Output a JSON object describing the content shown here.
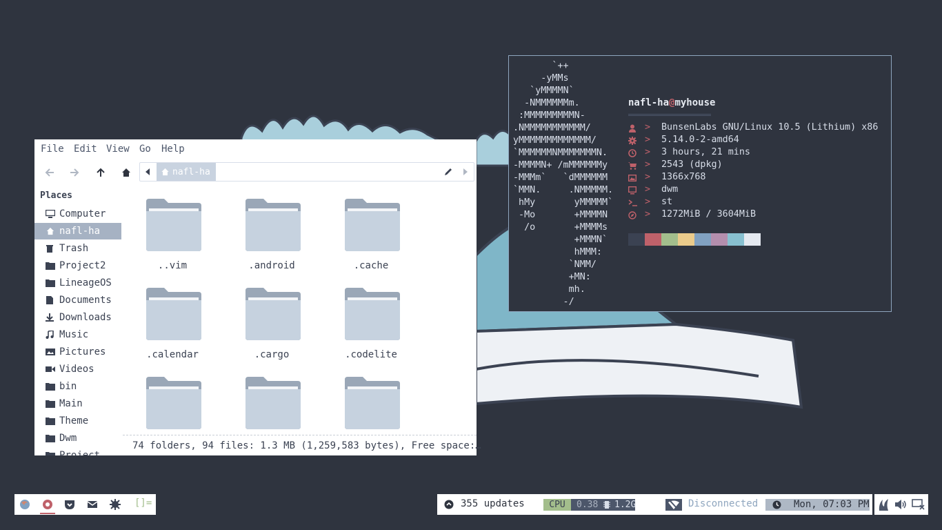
{
  "file_manager": {
    "menu": [
      "File",
      "Edit",
      "View",
      "Go",
      "Help"
    ],
    "path_crumb": "nafl-ha",
    "places_header": "Places",
    "places": [
      {
        "label": "Computer",
        "icon": "computer-icon"
      },
      {
        "label": "nafl-ha",
        "icon": "home-icon",
        "selected": true
      },
      {
        "label": "Trash",
        "icon": "trash-icon"
      },
      {
        "label": "Project2",
        "icon": "folder-icon"
      },
      {
        "label": "LineageOS",
        "icon": "folder-icon"
      },
      {
        "label": "Documents",
        "icon": "documents-icon"
      },
      {
        "label": "Downloads",
        "icon": "download-icon"
      },
      {
        "label": "Music",
        "icon": "music-icon"
      },
      {
        "label": "Pictures",
        "icon": "pictures-icon"
      },
      {
        "label": "Videos",
        "icon": "videos-icon"
      },
      {
        "label": "bin",
        "icon": "folder-icon"
      },
      {
        "label": "Main",
        "icon": "folder-icon"
      },
      {
        "label": "Theme",
        "icon": "folder-icon"
      },
      {
        "label": "Dwm",
        "icon": "folder-icon"
      },
      {
        "label": "Project",
        "icon": "folder-icon"
      }
    ],
    "files": [
      "..vim",
      ".android",
      ".cache",
      ".calendar",
      ".cargo",
      ".codelite",
      "",
      "",
      ""
    ],
    "status": "74 folders, 94 files: 1.3 MB (1,259,583 bytes), Free space:…"
  },
  "terminal": {
    "logo": "       `++\n     -yMMs\n   `yMMMMN`\n  -NMMMMMMm.\n :MMMMMMMMMN-\n.NMMMMMMMMMMM/\nyMMMMMMMMMMMMM/\n`MMMMMMNMMMMMMMN.\n-MMMMN+ /mMMMMMMy\n-MMMm`   `dMMMMMM\n`MMN.     .NMMMMM.\n hMy       yMMMMM`\n -Mo       +MMMMN\n  /o       +MMMMs\n           +MMMN`\n           hMMM:\n          `NMM/\n          +MN:\n          mh.\n         -/",
    "user": "nafl-ha",
    "at": "@",
    "host": "myhouse",
    "arrow": ">",
    "info": [
      {
        "icon": "user-icon",
        "value": "BunsenLabs GNU/Linux 10.5 (Lithium) x86"
      },
      {
        "icon": "gear-icon",
        "value": "5.14.0-2-amd64"
      },
      {
        "icon": "clock-icon",
        "value": "3 hours, 21 mins"
      },
      {
        "icon": "cart-icon",
        "value": "2543 (dpkg)"
      },
      {
        "icon": "image-icon",
        "value": "1366x768"
      },
      {
        "icon": "monitor-icon",
        "value": "dwm"
      },
      {
        "icon": "terminal-icon",
        "value": "st"
      },
      {
        "icon": "compass-icon",
        "value": "1272MiB / 3604MiB"
      }
    ],
    "palette": [
      "#3b4252",
      "#bf616a",
      "#a3be8c",
      "#ebcb8b",
      "#81a1c1",
      "#b48ead",
      "#88c0d0",
      "#e5e9f0"
    ]
  },
  "dock": {
    "apps": [
      "firefox-icon",
      "chrome-icon",
      "pocket-icon",
      "mail-icon",
      "settings-icon"
    ],
    "layout_symbol": "[]="
  },
  "statusbar": {
    "updates": "355 updates",
    "cpu_label": "CPU",
    "cpu_value": "0.38",
    "mem_value": "1.2G",
    "network": "Disconnected",
    "datetime": "Mon, 07:03 PM"
  },
  "colors": {
    "background": "#2f343f",
    "accent_red": "#bf616a",
    "accent_green": "#a3be8c",
    "wallpaper_blue": "#7fb6c8"
  }
}
